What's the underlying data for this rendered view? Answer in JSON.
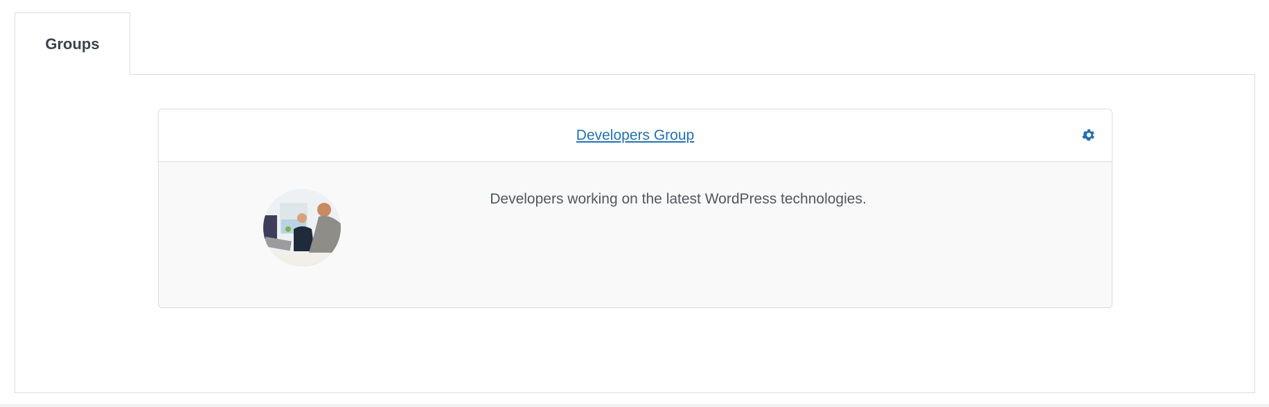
{
  "tabs": [
    {
      "label": "Groups",
      "active": true
    }
  ],
  "group": {
    "title": "Developers Group",
    "description": "Developers working on the latest WordPress technologies.",
    "settings_icon": "gear-icon",
    "avatar_icon": "group-avatar-photo"
  },
  "colors": {
    "link": "#2271b1",
    "text": "#50575e",
    "border": "#dcdcde",
    "card_bg": "#f9f9f9"
  }
}
